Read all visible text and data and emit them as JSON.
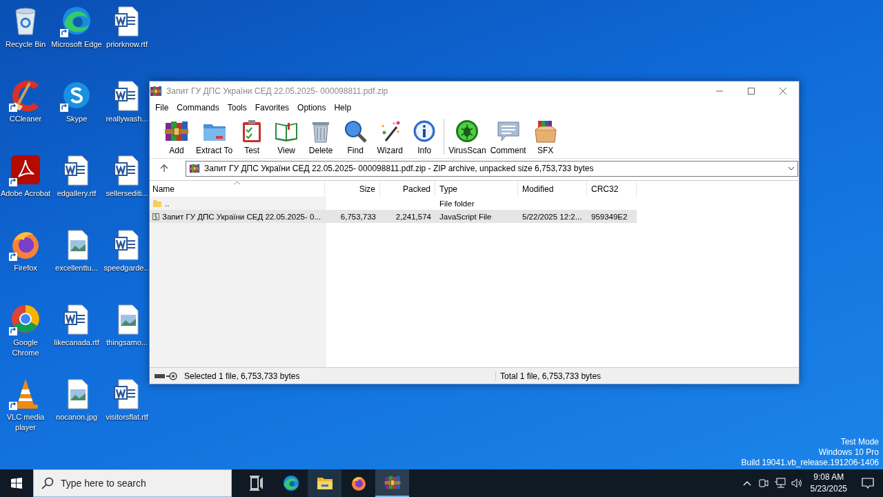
{
  "desktop": {
    "icons": [
      {
        "label": "Recycle Bin",
        "kind": "recycle",
        "shortcut": false
      },
      {
        "label": "Microsoft Edge",
        "kind": "edge",
        "shortcut": true
      },
      {
        "label": "priorknow.rtf",
        "kind": "word",
        "shortcut": false
      },
      {
        "label": "CCleaner",
        "kind": "ccleaner",
        "shortcut": true
      },
      {
        "label": "Skype",
        "kind": "skype",
        "shortcut": true
      },
      {
        "label": "reallywash...",
        "kind": "word",
        "shortcut": false
      },
      {
        "label": "Adobe Acrobat",
        "kind": "acrobat",
        "shortcut": true
      },
      {
        "label": "edgallery.rtf",
        "kind": "word",
        "shortcut": false
      },
      {
        "label": "sellersediti...",
        "kind": "word",
        "shortcut": false
      },
      {
        "label": "Firefox",
        "kind": "firefox",
        "shortcut": true
      },
      {
        "label": "excellenttu...",
        "kind": "image",
        "shortcut": false
      },
      {
        "label": "speedgarde...",
        "kind": "word",
        "shortcut": false
      },
      {
        "label": "Google Chrome",
        "kind": "chrome",
        "shortcut": true
      },
      {
        "label": "likecanada.rtf",
        "kind": "word",
        "shortcut": false
      },
      {
        "label": "thingsamo...",
        "kind": "image",
        "shortcut": false
      },
      {
        "label": "VLC media player",
        "kind": "vlc",
        "shortcut": true
      },
      {
        "label": "nocanon.jpg",
        "kind": "image",
        "shortcut": false
      },
      {
        "label": "visitorsflat.rtf",
        "kind": "word",
        "shortcut": false
      }
    ]
  },
  "window": {
    "title": "Запит ГУ ДПС України СЕД 22.05.2025- 000098811.pdf.zip",
    "menu": [
      "File",
      "Commands",
      "Tools",
      "Favorites",
      "Options",
      "Help"
    ],
    "toolbar": [
      {
        "label": "Add",
        "kind": "add"
      },
      {
        "label": "Extract To",
        "kind": "extract"
      },
      {
        "label": "Test",
        "kind": "test"
      },
      {
        "label": "View",
        "kind": "view"
      },
      {
        "label": "Delete",
        "kind": "delete"
      },
      {
        "label": "Find",
        "kind": "find"
      },
      {
        "label": "Wizard",
        "kind": "wizard"
      },
      {
        "label": "Info",
        "kind": "info"
      },
      {
        "label": "VirusScan",
        "kind": "virus"
      },
      {
        "label": "Comment",
        "kind": "comment"
      },
      {
        "label": "SFX",
        "kind": "sfx"
      }
    ],
    "address": {
      "value": "Запит ГУ ДПС України СЕД 22.05.2025- 000098811.pdf.zip - ZIP archive, unpacked size 6,753,733 bytes"
    },
    "columns": [
      {
        "label": "Name",
        "sorted": true
      },
      {
        "label": "Size",
        "sorted": false
      },
      {
        "label": "Packed",
        "sorted": false
      },
      {
        "label": "Type",
        "sorted": false
      },
      {
        "label": "Modified",
        "sorted": false
      },
      {
        "label": "CRC32",
        "sorted": false
      }
    ],
    "rows": [
      {
        "kind": "folder",
        "selected": false,
        "name": "..",
        "type": "File folder"
      },
      {
        "kind": "script",
        "selected": true,
        "name": "Запит ГУ ДПС України СЕД 22.05.2025- 0...",
        "size": "6,753,733",
        "packed": "2,241,574",
        "type": "JavaScript File",
        "modified": "5/22/2025 12:2...",
        "crc32": "959349E2"
      }
    ],
    "status_bar": [
      "Selected 1 file, 6,753,733 bytes",
      "Total 1 file, 6,753,733 bytes"
    ]
  },
  "system_info": [
    "Test Mode",
    "Windows 10 Pro",
    "Build 19041.vb_release.191206-1406"
  ],
  "taskbar": {
    "search": {
      "placeholder": "Type here to search"
    },
    "apps": [
      {
        "kind": "taskview",
        "open": false,
        "selected": false
      },
      {
        "kind": "edge",
        "open": false,
        "selected": false
      },
      {
        "kind": "explorer",
        "open": true,
        "selected": false
      },
      {
        "kind": "firefox",
        "open": false,
        "selected": false
      },
      {
        "kind": "winrar",
        "open": true,
        "selected": true
      }
    ],
    "tray": [
      {
        "kind": "chevron"
      },
      {
        "kind": "meet"
      },
      {
        "kind": "network"
      },
      {
        "kind": "volume"
      }
    ],
    "clock": {
      "time": "9:08 AM",
      "date": "5/23/2025"
    }
  }
}
